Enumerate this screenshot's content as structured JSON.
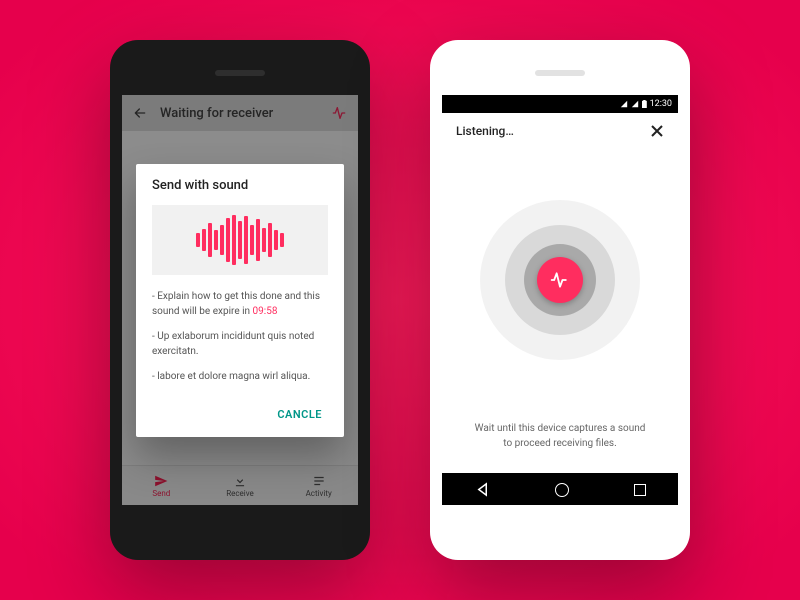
{
  "statusbar": {
    "time": "12:30"
  },
  "phone1": {
    "appbar_title": "Waiting for receiver",
    "tabs": {
      "send": "Send",
      "receive": "Receive",
      "activity": "Activity"
    },
    "dialog": {
      "title": "Send with sound",
      "line1_prefix": "- Explain how to get this done and this sound will be expire in ",
      "countdown": "09:58",
      "line2": "- Up exlaborum incididunt quis noted exercitatn.",
      "line3": "- labore et dolore magna wirl aliqua.",
      "cancel": "CANCLE"
    }
  },
  "phone2": {
    "title": "Listening…",
    "message": "Wait until this device captures a sound to proceed receiving files."
  },
  "wave_heights": [
    14,
    22,
    34,
    20,
    30,
    44,
    50,
    38,
    48,
    30,
    42,
    24,
    34,
    20,
    14
  ]
}
